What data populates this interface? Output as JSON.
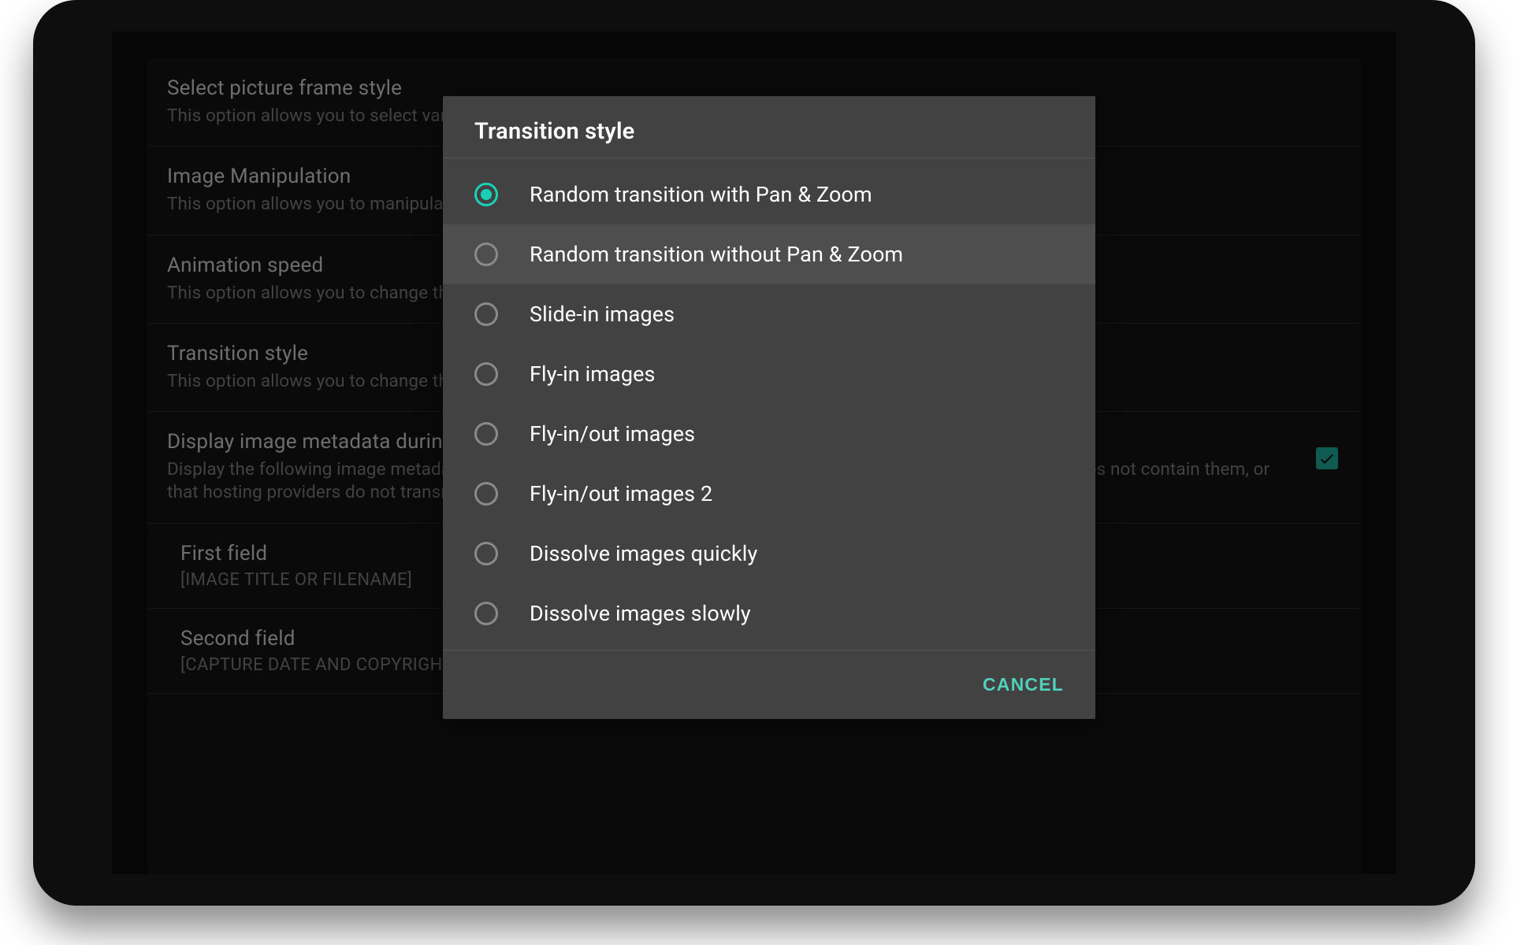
{
  "settings": [
    {
      "title": "Select picture frame style",
      "subtitle": "This option allows you to select various picture frame styles and effects."
    },
    {
      "title": "Image Manipulation",
      "subtitle": "This option allows you to manipulate the displayed images."
    },
    {
      "title": "Animation speed",
      "subtitle": "This option allows you to change the overall speed of the animation."
    },
    {
      "title": "Transition style",
      "subtitle": "This option allows you to change the style of transition between images."
    },
    {
      "title": "Display image metadata during slideshow",
      "subtitle": "Display the following image metadata in slideshow mode. For fields with no data shown, it may be that the image does not contain them, or that hosting providers do not transmit them.",
      "checkbox": true,
      "checked": true
    },
    {
      "title": "First field",
      "subtitle_caps": "[IMAGE TITLE OR FILENAME]",
      "indented": true
    },
    {
      "title": "Second field",
      "subtitle_caps": "[CAPTURE DATE AND COPYRIGHT]",
      "indented": true
    }
  ],
  "dialog": {
    "title": "Transition style",
    "options": [
      {
        "label": "Random transition with Pan & Zoom",
        "selected": true
      },
      {
        "label": "Random transition without Pan & Zoom",
        "hover": true
      },
      {
        "label": "Slide-in images"
      },
      {
        "label": "Fly-in images"
      },
      {
        "label": "Fly-in/out images"
      },
      {
        "label": "Fly-in/out images 2"
      },
      {
        "label": "Dissolve images quickly"
      },
      {
        "label": "Dissolve images slowly"
      }
    ],
    "cancel_label": "CANCEL"
  },
  "colors": {
    "accent": "#1ad1b7",
    "dialog_bg": "#424242"
  }
}
